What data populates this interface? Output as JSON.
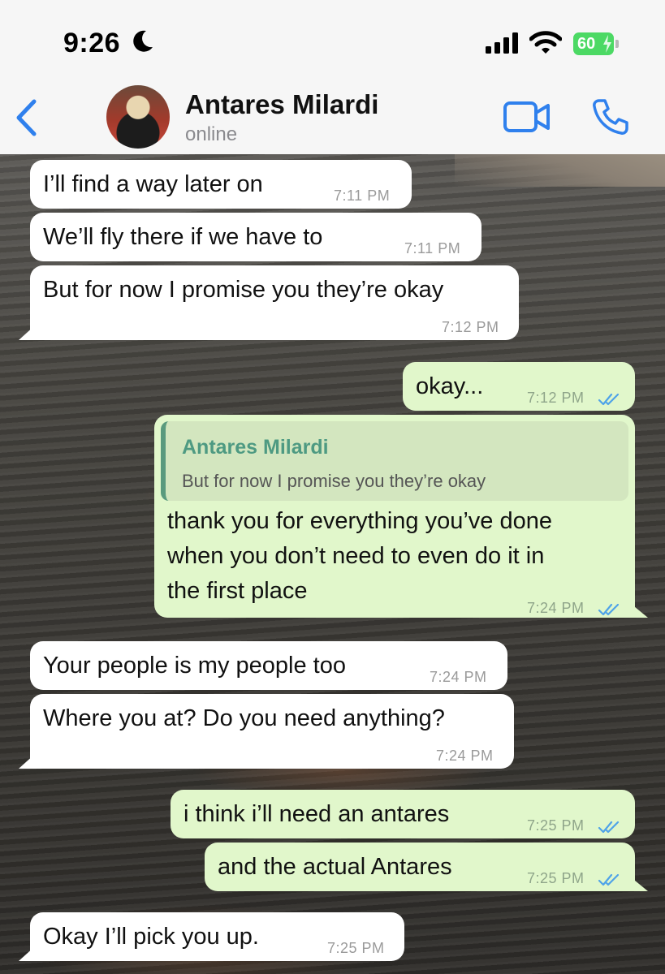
{
  "status_bar": {
    "time": "9:26",
    "battery": "60"
  },
  "header": {
    "contact_name": "Antares Milardi",
    "contact_status": "online"
  },
  "messages": [
    {
      "text": "I’ll find a way later on",
      "time": "7:11 PM"
    },
    {
      "text": "We’ll fly there if we have to",
      "time": "7:11 PM"
    },
    {
      "text": "But for now I promise you they’re okay",
      "time": "7:12 PM"
    },
    {
      "text": "okay...",
      "time": "7:12 PM"
    },
    {
      "quote_name": "Antares Milardi",
      "quote_text": "But for now I promise you they’re okay",
      "line1": "thank you for everything you’ve done",
      "line2": "when you don’t need to even do it in",
      "line3": "the first place",
      "time": "7:24 PM"
    },
    {
      "text": "Your people is my people too",
      "time": "7:24 PM"
    },
    {
      "text": "Where you at? Do you need anything?",
      "time": "7:24 PM"
    },
    {
      "text": "i think i’ll need an antares",
      "time": "7:25 PM"
    },
    {
      "text": "and the actual Antares",
      "time": "7:25 PM"
    },
    {
      "text": "Okay I’ll pick you up.",
      "time": "7:25 PM"
    }
  ],
  "colors": {
    "accent": "#2f80ed",
    "incoming_bubble": "#ffffff",
    "outgoing_bubble": "#e1f7cb",
    "read_ticks": "#4fa3e8"
  },
  "icons": {
    "back": "chevron-left-icon",
    "video": "video-camera-icon",
    "call": "phone-icon",
    "read": "double-check-icon"
  }
}
